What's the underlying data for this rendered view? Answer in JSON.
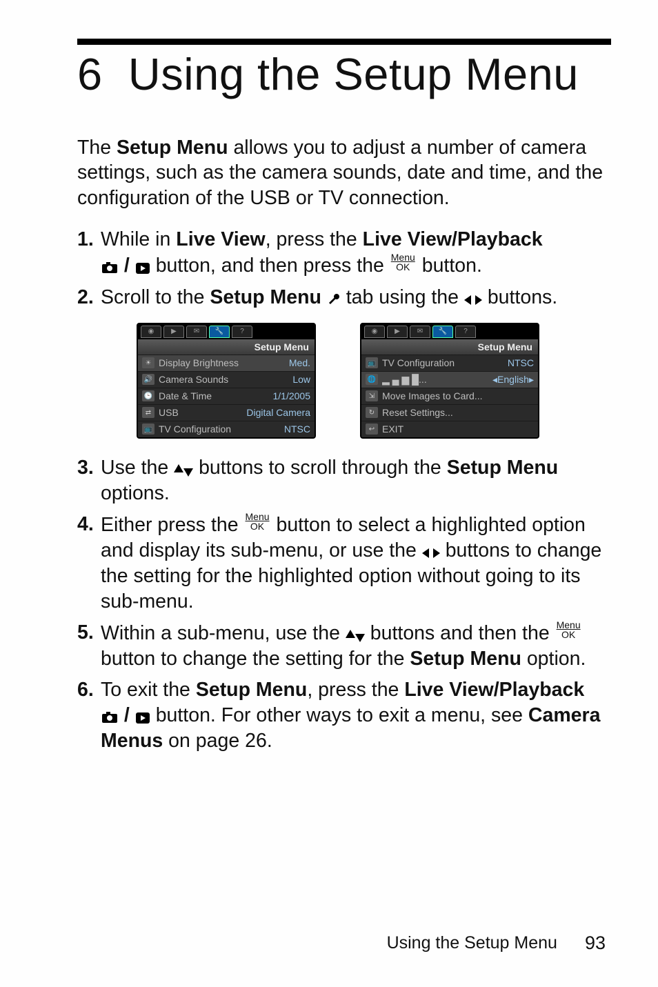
{
  "chapter": {
    "number": "6",
    "title": "Using the Setup Menu"
  },
  "intro": {
    "prefix": "The ",
    "bold": "Setup Menu",
    "rest": " allows you to adjust a number of camera settings, such as the camera sounds, date and time, and the configuration of the USB or TV connection."
  },
  "steps": {
    "s1": {
      "a": "While in ",
      "b": "Live View",
      "c": ", press the ",
      "d": "Live View/Playback",
      "e": " button, and then press the ",
      "f": " button."
    },
    "s2": {
      "a": "Scroll to the ",
      "b": "Setup Menu",
      "c": " tab using the ",
      "d": " buttons."
    },
    "s3": {
      "a": "Use the ",
      "b": " buttons to scroll through the ",
      "c": "Setup Menu",
      "d": " options."
    },
    "s4": {
      "a": "Either press the ",
      "b": " button to select a highlighted option and display its sub-menu, or use the ",
      "c": " buttons to change the setting for the highlighted option without going to its sub-menu."
    },
    "s5": {
      "a": "Within a sub-menu, use the ",
      "b": " buttons and then the ",
      "c": " button to change the setting for the ",
      "d": "Setup Menu",
      "e": " option."
    },
    "s6": {
      "a": "To exit the ",
      "b": "Setup Menu",
      "c": ", press the ",
      "d": "Live View/Playback",
      "e": " button. For other ways to exit a menu, see ",
      "f": "Camera Menus",
      "g": " on page 26."
    }
  },
  "menuok": {
    "menu": "Menu",
    "ok": "OK"
  },
  "screen1": {
    "title": "Setup Menu",
    "rows": [
      {
        "label": "Display Brightness",
        "val": "Med."
      },
      {
        "label": "Camera Sounds",
        "val": "Low"
      },
      {
        "label": "Date & Time",
        "val": "1/1/2005"
      },
      {
        "label": "USB",
        "val": "Digital Camera"
      },
      {
        "label": "TV Configuration",
        "val": "NTSC"
      }
    ]
  },
  "screen2": {
    "title": "Setup Menu",
    "rows": [
      {
        "label": "TV Configuration",
        "val": "NTSC"
      },
      {
        "label": "▂ ▄ ▆ █...",
        "val": "◂English▸"
      },
      {
        "label": "Move Images to Card...",
        "val": ""
      },
      {
        "label": "Reset Settings...",
        "val": ""
      },
      {
        "label": "EXIT",
        "val": ""
      }
    ]
  },
  "footer": {
    "text": "Using the Setup Menu",
    "page": "93"
  }
}
